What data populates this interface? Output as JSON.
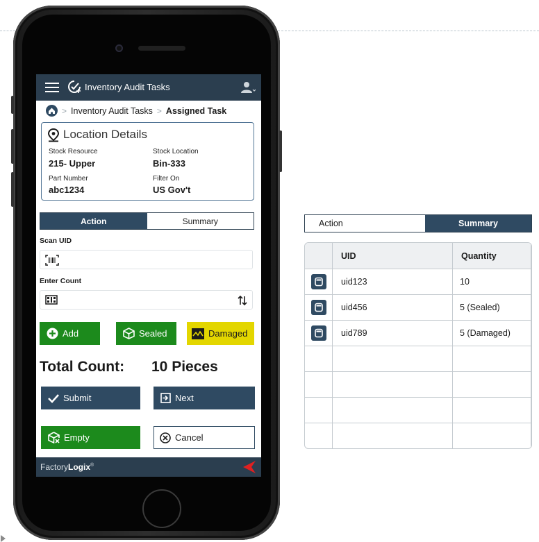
{
  "app": {
    "title": "Inventory Audit Tasks"
  },
  "breadcrumb": {
    "items": [
      "Inventory Audit Tasks",
      "Assigned Task"
    ]
  },
  "location": {
    "title": "Location Details",
    "fields": [
      {
        "label": "Stock Resource",
        "value": "215- Upper"
      },
      {
        "label": "Stock Location",
        "value": "Bin-333"
      },
      {
        "label": "Part Number",
        "value": "abc1234"
      },
      {
        "label": "Filter On",
        "value": "US Gov't"
      }
    ]
  },
  "tabs": {
    "action": "Action",
    "summary": "Summary"
  },
  "scan": {
    "label": "Scan UID",
    "value": ""
  },
  "count": {
    "label": "Enter Count",
    "value": ""
  },
  "buttons": {
    "add": "Add",
    "sealed": "Sealed",
    "damaged": "Damaged",
    "submit": "Submit",
    "next": "Next",
    "empty": "Empty",
    "cancel": "Cancel"
  },
  "total": {
    "label": "Total Count:",
    "value": "10 Pieces"
  },
  "footer": {
    "brand_part1": "Factory",
    "brand_part2": "Logix",
    "brand_mark": "®"
  },
  "summary_table": {
    "headers": {
      "uid": "UID",
      "quantity": "Quantity"
    },
    "rows": [
      {
        "uid": "uid123",
        "quantity": "10"
      },
      {
        "uid": "uid456",
        "quantity": "5 (Sealed)"
      },
      {
        "uid": "uid789",
        "quantity": "5 (Damaged)"
      }
    ]
  },
  "colors": {
    "navy": "#2b3e4f",
    "green": "#1c8a1c",
    "yellow": "#e3d600",
    "logo_red": "#e02020"
  },
  "icons": [
    "menu-icon",
    "task-check-icon",
    "user-icon",
    "home-icon",
    "location-pin-icon",
    "barcode-icon",
    "keypad-icon",
    "sort-arrows-icon",
    "plus-circle-icon",
    "box-icon",
    "damaged-icon",
    "check-icon",
    "next-icon",
    "empty-box-icon",
    "cancel-circle-icon",
    "trash-icon"
  ]
}
